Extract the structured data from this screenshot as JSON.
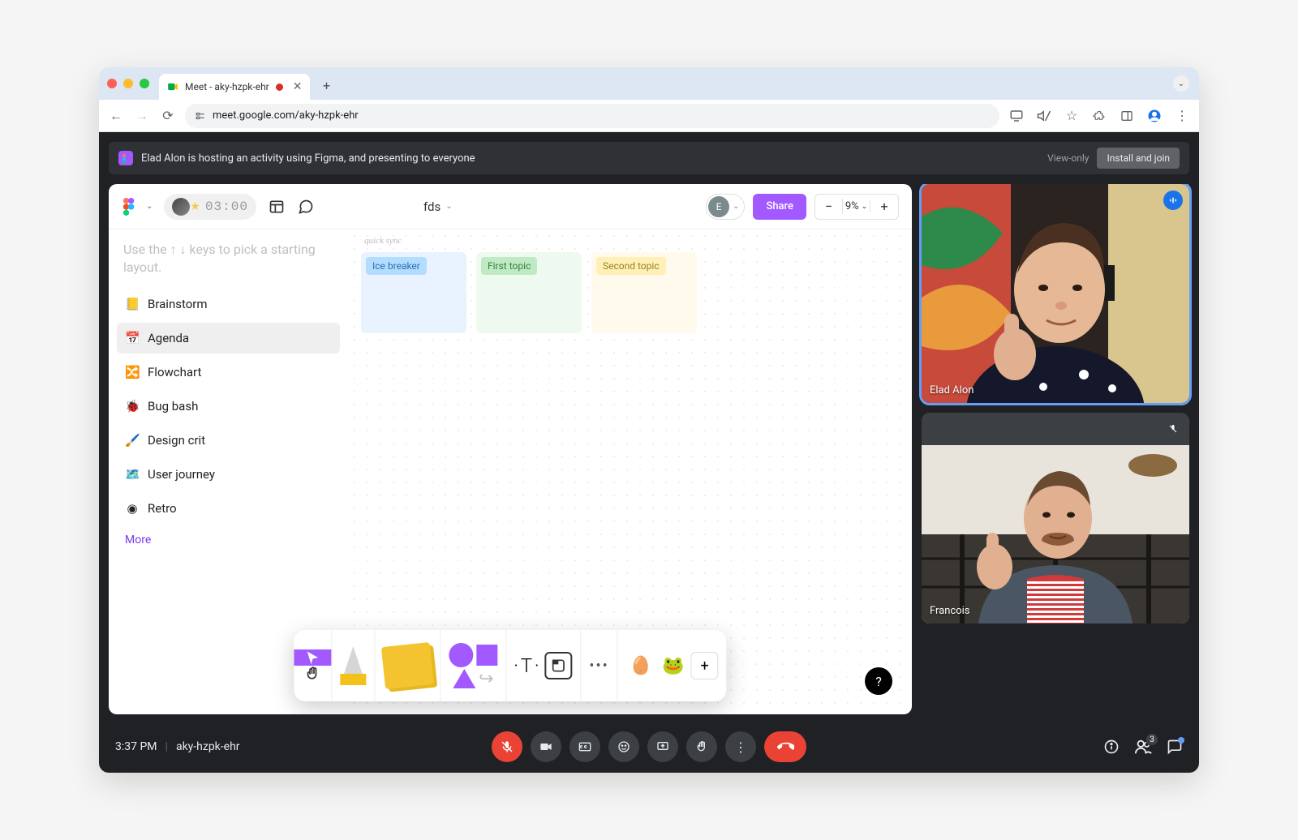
{
  "browser": {
    "tab_title": "Meet - aky-hzpk-ehr",
    "url": "meet.google.com/aky-hzpk-ehr"
  },
  "notify": {
    "message": "Elad Alon is hosting an activity using Figma, and presenting to everyone",
    "view_only": "View-only",
    "install": "Install and join"
  },
  "figma": {
    "timer": "03:00",
    "filename": "fds",
    "avatar_initial": "E",
    "share": "Share",
    "zoom": "9%",
    "hint": "Use the ↑ ↓ keys to pick a starting layout.",
    "layouts": [
      {
        "icon": "📒",
        "label": "Brainstorm"
      },
      {
        "icon": "📅",
        "label": "Agenda"
      },
      {
        "icon": "🔀",
        "label": "Flowchart"
      },
      {
        "icon": "🐞",
        "label": "Bug bash"
      },
      {
        "icon": "🖌️",
        "label": "Design crit"
      },
      {
        "icon": "🗺️",
        "label": "User journey"
      },
      {
        "icon": "◉",
        "label": "Retro"
      }
    ],
    "more": "More",
    "canvas_caption": "quick sync",
    "cards": {
      "ice": "Ice breaker",
      "first": "First topic",
      "second": "Second topic"
    }
  },
  "participants": {
    "p1": "Elad Alon",
    "p2": "Francois"
  },
  "meet_bar": {
    "time": "3:37 PM",
    "code": "aky-hzpk-ehr",
    "people_count": "3"
  }
}
